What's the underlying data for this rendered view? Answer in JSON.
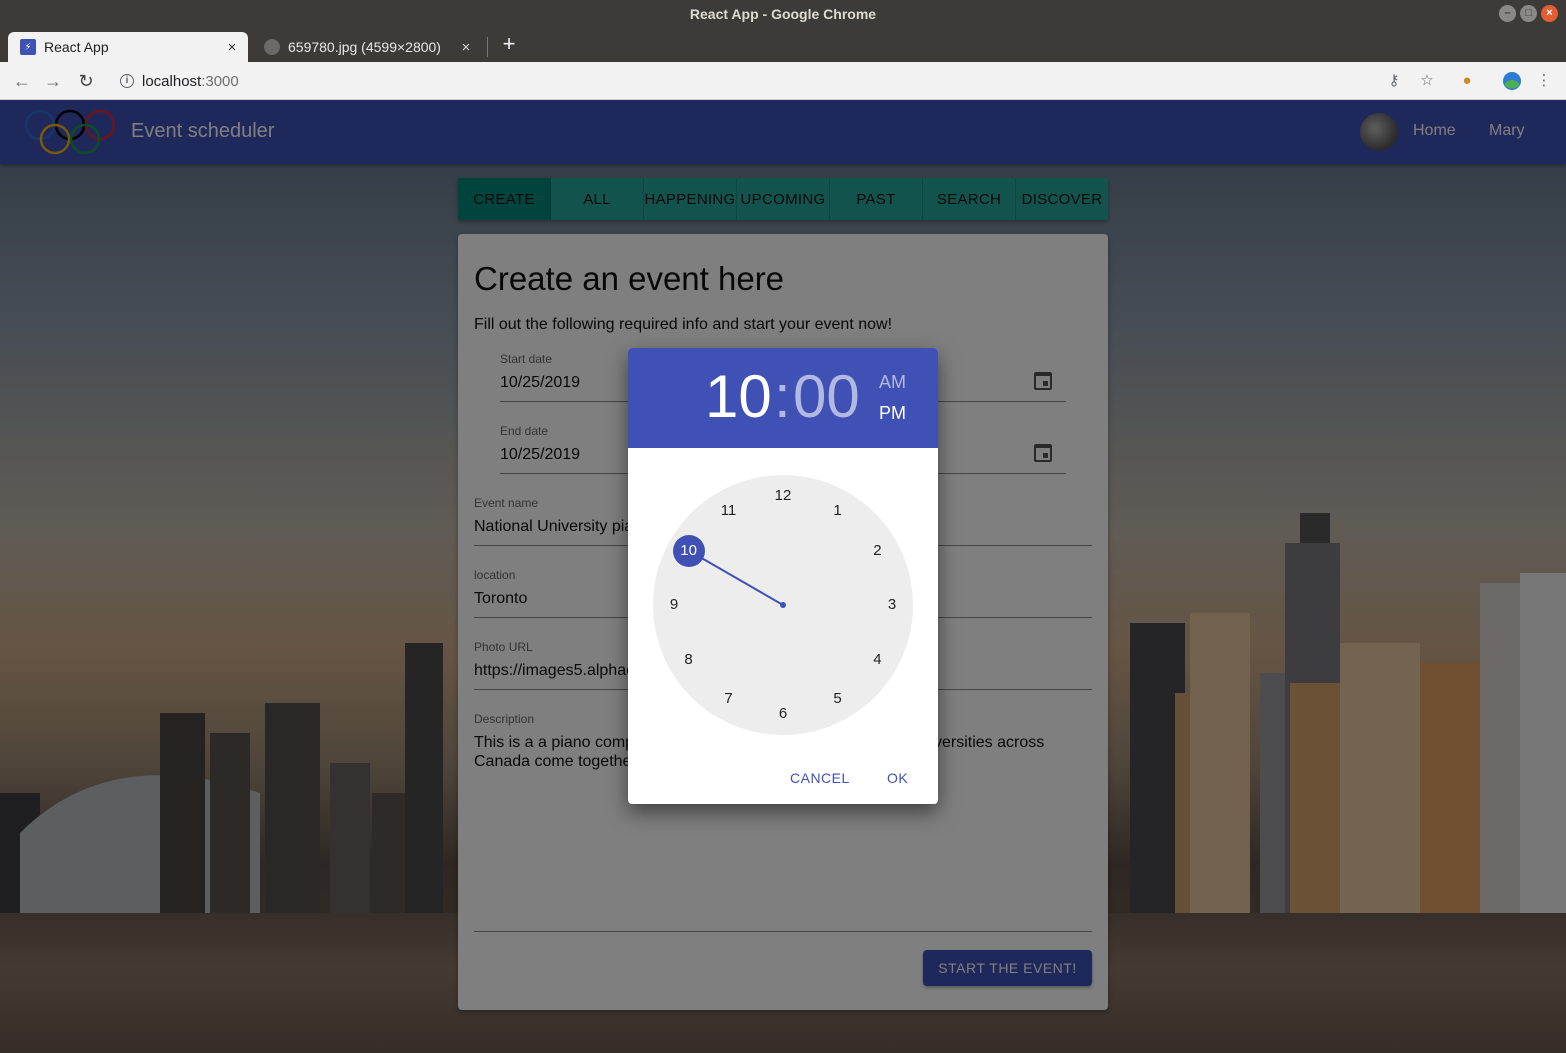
{
  "browser": {
    "window_title": "React App - Google Chrome",
    "tabs": [
      {
        "label": "React App",
        "close": "×"
      },
      {
        "label": "659780.jpg (4599×2800)",
        "close": "×"
      }
    ],
    "new_tab": "+",
    "url_host": "localhost",
    "url_port": ":3000"
  },
  "app": {
    "title": "Event scheduler",
    "nav": {
      "home": "Home",
      "user": "Mary"
    },
    "tabs": [
      "CREATE",
      "ALL",
      "HAPPENING",
      "UPCOMING",
      "PAST",
      "SEARCH",
      "DISCOVER"
    ],
    "active_tab": "CREATE"
  },
  "form": {
    "heading": "Create an event here",
    "subtitle": "Fill out the following required info and start your event now!",
    "start_date": {
      "label": "Start date",
      "value": "10/25/2019"
    },
    "end_date": {
      "label": "End date",
      "value": "10/25/2019"
    },
    "event_name": {
      "label": "Event name",
      "value": "National University pia"
    },
    "location": {
      "label": "location",
      "value": "Toronto"
    },
    "photo_url": {
      "label": "Photo URL",
      "value": "https://images5.alphac"
    },
    "description": {
      "label": "Description",
      "line1_left": "This is a a piano comp",
      "line1_right": "versities across",
      "line2": "Canada come togethe"
    },
    "submit": "START THE EVENT!"
  },
  "time_picker": {
    "hour": "10",
    "separator": ":",
    "minute": "00",
    "am": "AM",
    "pm": "PM",
    "selected_period": "PM",
    "selected_hour": 10,
    "clock_numbers": [
      "12",
      "1",
      "2",
      "3",
      "4",
      "5",
      "6",
      "7",
      "8",
      "9",
      "10",
      "11"
    ],
    "cancel": "CANCEL",
    "ok": "OK"
  },
  "colors": {
    "primary": "#3f51b5",
    "tabs_bg": "#26a69a",
    "tab_active": "#00897b"
  }
}
